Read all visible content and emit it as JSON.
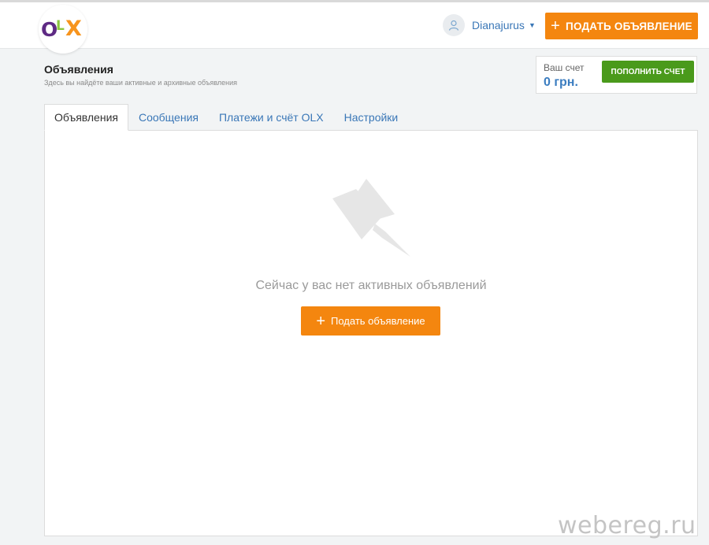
{
  "header": {
    "logo": {
      "text_o": "O",
      "text_l": "L",
      "text_x": "X",
      "colors": [
        "#5e2a84",
        "#8cc63f",
        "#f7941d"
      ]
    },
    "user": {
      "icon": "user-icon",
      "name": "Dianajurus",
      "caret": "▼"
    },
    "post_button": {
      "icon": "plus-icon",
      "plus": "+",
      "label": "ПОДАТЬ ОБЪЯВЛЕНИЕ",
      "color": "#f4860f"
    }
  },
  "page": {
    "title": "Объявления",
    "subtitle": "Здесь вы найдёте ваши активные и архивные объявления"
  },
  "account": {
    "label": "Ваш счет",
    "value": "0 грн.",
    "topup_label": "ПОПОЛНИТЬ СЧЕТ",
    "topup_color": "#4a9a1b"
  },
  "tabs": [
    {
      "label": "Объявления",
      "active": true
    },
    {
      "label": "Сообщения",
      "active": false
    },
    {
      "label": "Платежи и счёт OLX",
      "active": false
    },
    {
      "label": "Настройки",
      "active": false
    }
  ],
  "empty_state": {
    "icon": "pin-icon",
    "message": "Сейчас у вас нет активных объявлений",
    "button": {
      "icon": "plus-icon",
      "plus": "+",
      "label": "Подать объявление"
    }
  },
  "watermark": "webereg.ru"
}
